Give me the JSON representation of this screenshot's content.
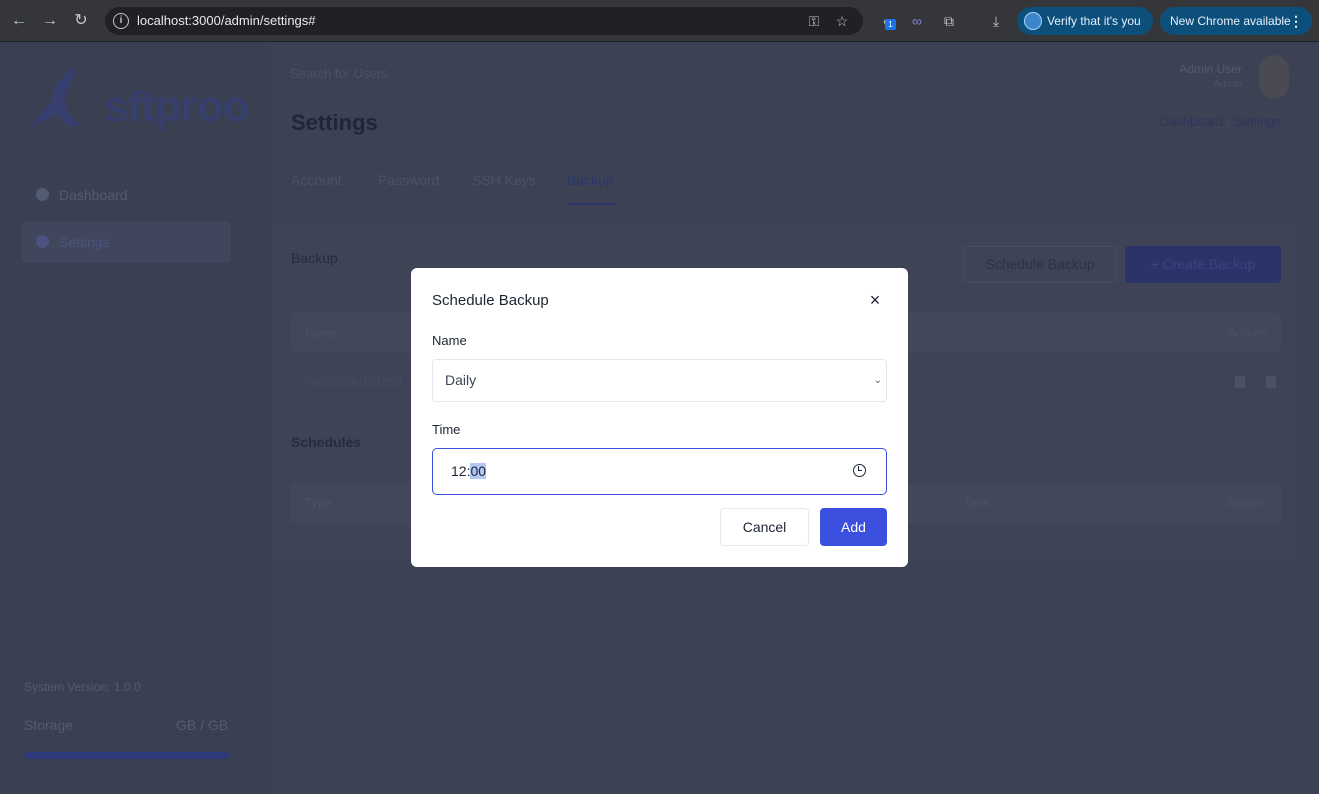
{
  "browser": {
    "url": "localhost:3000/admin/settings#",
    "ext_badge": "1",
    "verify_label": "Verify that it's you",
    "update_label": "New Chrome available",
    "back_glyph": "←",
    "forward_glyph": "→",
    "reload_glyph": "↻",
    "menu_glyph": "⋮"
  },
  "sidebar": {
    "logo_text": "sftproo",
    "items": [
      {
        "label": "Dashboard",
        "icon": "pie-chart-icon"
      },
      {
        "label": "Settings",
        "icon": "gear-icon"
      }
    ],
    "system_version": "System Version: 1.0.0",
    "storage_label": "Storage",
    "storage_value": "GB / GB"
  },
  "header": {
    "search_placeholder": "Search for Users",
    "user_name": "Admin User",
    "user_role": "Admin"
  },
  "page": {
    "title": "Settings",
    "breadcrumb": [
      "Dashboard",
      "Settings"
    ],
    "breadcrumb_sep": "/",
    "tabs": [
      "Account",
      "Password",
      "SSH Keys",
      "Backup"
    ]
  },
  "backup": {
    "title": "Backup",
    "schedule_button": "Schedule Backup",
    "create_button": "+ Create Backup",
    "columns": [
      "Name",
      "Actions"
    ],
    "rows": [
      {
        "name": "06032026-101859"
      }
    ],
    "schedules_title": "Schedules",
    "schedule_columns": [
      "Type",
      "Time",
      "Actions"
    ]
  },
  "modal": {
    "title": "Schedule Backup",
    "close_glyph": "×",
    "name_label": "Name",
    "name_value": "Daily",
    "time_label": "Time",
    "time_hour": "12:",
    "time_minute": "00",
    "cancel_label": "Cancel",
    "add_label": "Add",
    "colors": {
      "primary": "#3c50e0",
      "overlay": "#3c4254"
    }
  }
}
